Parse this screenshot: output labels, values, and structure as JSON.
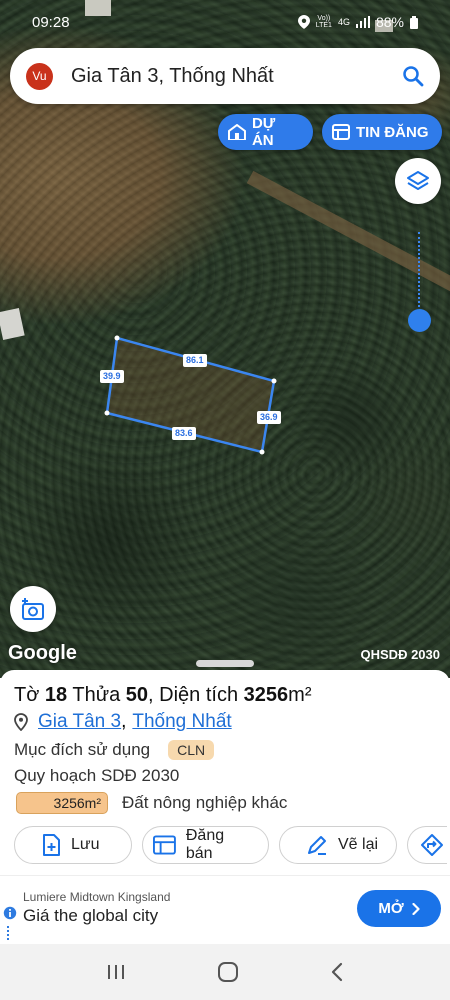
{
  "status_bar": {
    "time": "09:28",
    "network_top": "Vo))",
    "network_bottom": "LTE1",
    "network_type": "4G",
    "battery": "88%"
  },
  "search": {
    "avatar_text": "Vu",
    "query": "Gia Tân 3, Thống Nhất",
    "icon": "search-icon"
  },
  "top_buttons": {
    "du_an": "DỰ ÁN",
    "tin_dang": "TIN ĐĂNG"
  },
  "map": {
    "attribution": "Google",
    "layer_label": "QHSDĐ 2030",
    "parcel_edges": {
      "top": "86.1",
      "left": "39.9",
      "right": "36.9",
      "bottom": "83.6"
    },
    "parcel_color": "#3b86f0"
  },
  "parcel": {
    "to_label": "Tờ",
    "to_number": "18",
    "thua_label": "Thửa",
    "thua_number": "50",
    "area_label": "Diện tích",
    "area_value": "3256",
    "area_unit": "m²",
    "location_ward": "Gia Tân 3",
    "location_sep": ",",
    "location_district": "Thống Nhất",
    "purpose_label": "Mục đích sử dụng",
    "purpose_code": "CLN",
    "plan_label": "Quy hoạch SDĐ 2030",
    "plan_area": "3256m²",
    "plan_desc": "Đất nông nghiệp khác",
    "plan_color": "#f6c48c"
  },
  "actions": {
    "save": "Lưu",
    "sell": "Đăng bán",
    "redraw": "Vẽ lại"
  },
  "ad": {
    "advertiser": "Lumiere Midtown Kingsland",
    "headline": "Giá the global city",
    "cta": "MỞ"
  },
  "colors": {
    "accent": "#2f7bea",
    "link": "#1f6fd6",
    "avatar": "#c9321b"
  }
}
